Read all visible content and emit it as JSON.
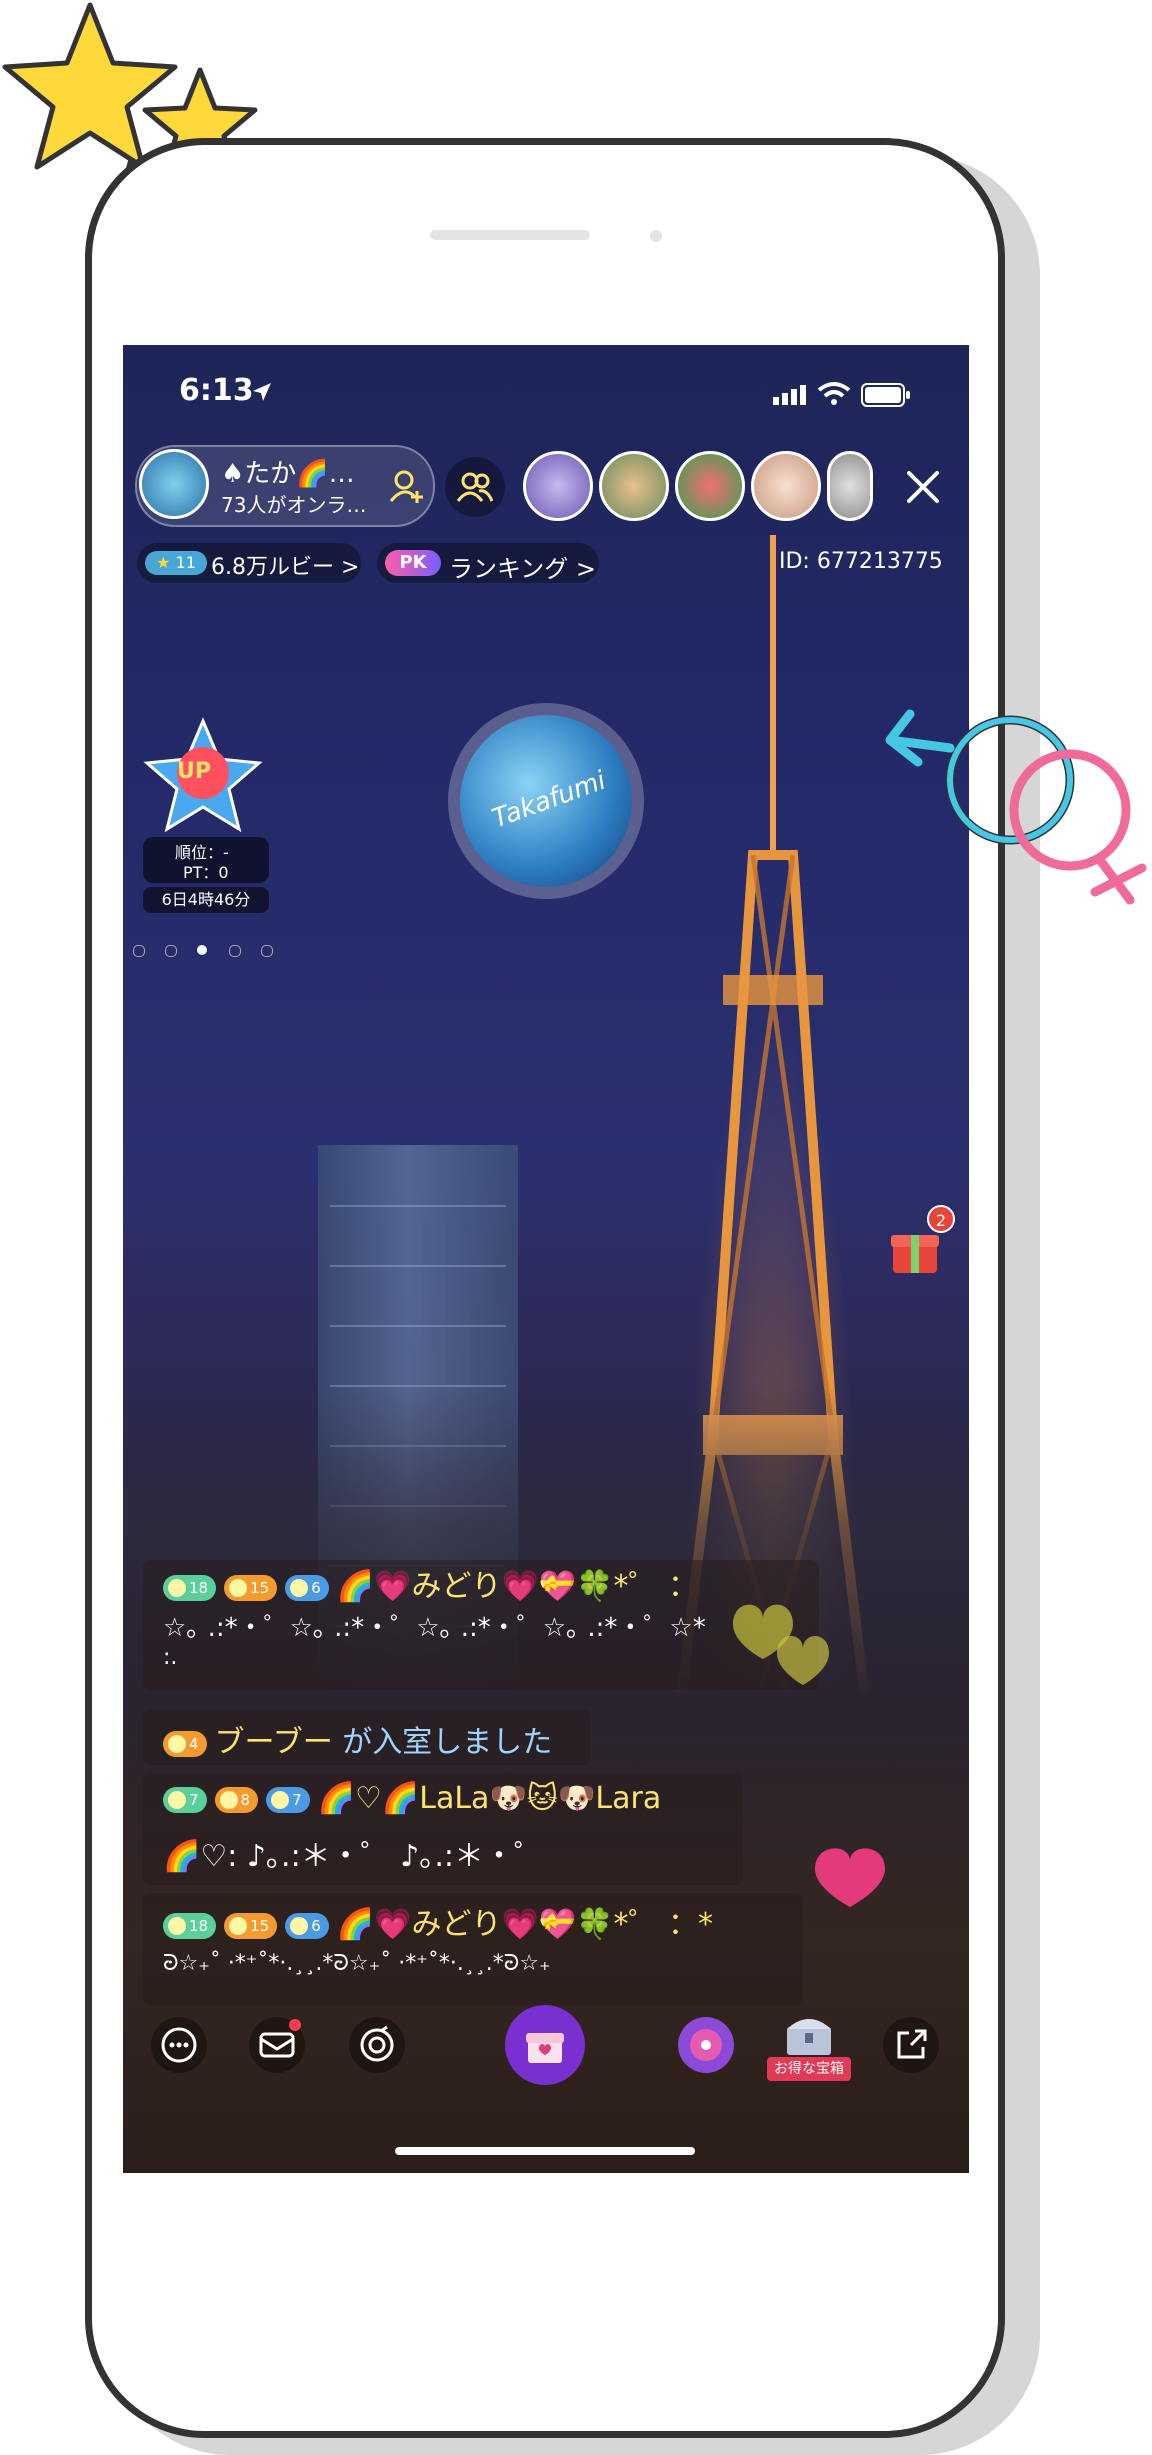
{
  "status_bar": {
    "time": "6:13"
  },
  "host": {
    "name": "♠たか🌈…",
    "online": "73人がオンラ…"
  },
  "ruby_badge": {
    "level": "11",
    "label": "6.8万ルビー >"
  },
  "pk": {
    "badge": "PK",
    "label": "ランキング >"
  },
  "room_id": "ID: 677213775",
  "event": {
    "rank_label": "順位：-",
    "pt_label": "PT：0",
    "countdown": "6日4時46分",
    "logo_text": "UP"
  },
  "center_avatar_text": "Takafumi",
  "gift_count": "2",
  "chat": {
    "line1": {
      "badges": [
        "18",
        "15",
        "6"
      ],
      "name": "🌈💗みどり💗💝🍀*゜ ：",
      "message": "☆｡ .:*・゜☆｡ .:*・゜☆｡ .:*・゜☆｡ .:*・゜☆*",
      "message2": ":."
    },
    "entry": {
      "badge": "4",
      "name": "ブーブー",
      "text": "が入室しました"
    },
    "line2": {
      "badges": [
        "7",
        "8",
        "7"
      ],
      "name": "🌈♡🌈LaLa🐶🐱🐶Lara",
      "message": "🌈♡: ♪｡.:＊・゜ ♪｡.:＊・゜"
    },
    "line3": {
      "badges": [
        "18",
        "15",
        "6"
      ],
      "name": "🌈💗みどり💗💝🍀*゜ ：*",
      "message": "ᘒ☆₊˚ ·*⁺˚*·.¸¸.*ᘒ☆₊˚ ·*⁺˚*·.¸¸.*ᘒ☆₊"
    }
  },
  "toolbar": {
    "treasure_label": "お得な宝箱"
  },
  "colors": {
    "accent_purple": "#7a2fd1",
    "badge_green": "#5bcf9a",
    "badge_orange": "#f39b2c",
    "badge_blue": "#4a9be3",
    "name_yellow": "#ffe46c"
  }
}
